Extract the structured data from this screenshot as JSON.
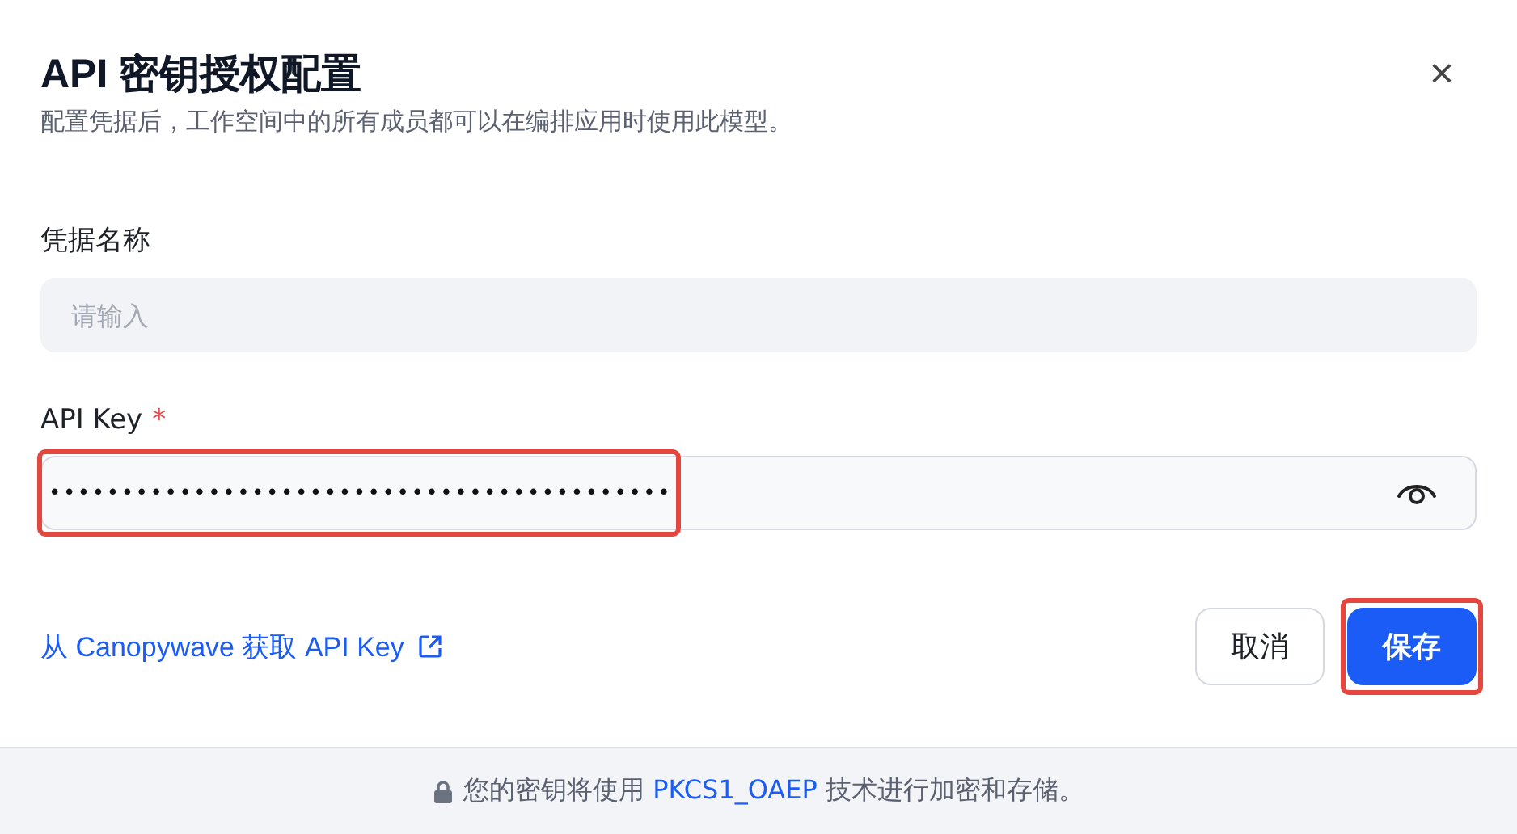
{
  "dialog": {
    "title": "API 密钥授权配置",
    "subtitle": "配置凭据后，工作空间中的所有成员都可以在编排应用时使用此模型。",
    "close": "×"
  },
  "fields": [
    {
      "label": "凭据名称",
      "placeholder": "请输入",
      "highlighted": false,
      "reveal_toggle": false
    },
    {
      "label": "API Key",
      "required_mark": "*",
      "value": "•••••••••••••••••••••••••••••••••••••••••••",
      "highlighted": true,
      "reveal_toggle": true
    }
  ],
  "link": {
    "text": "从 Canopywave 获取 API Key"
  },
  "buttons": [
    {
      "label": "取消",
      "kind": "secondary",
      "highlighted": false
    },
    {
      "label": "保存",
      "kind": "primary",
      "highlighted": true
    }
  ],
  "footer": {
    "text_before": "您的密钥将使用 ",
    "link": "PKCS1_OAEP",
    "text_after": " 技术进行加密和存储。"
  }
}
